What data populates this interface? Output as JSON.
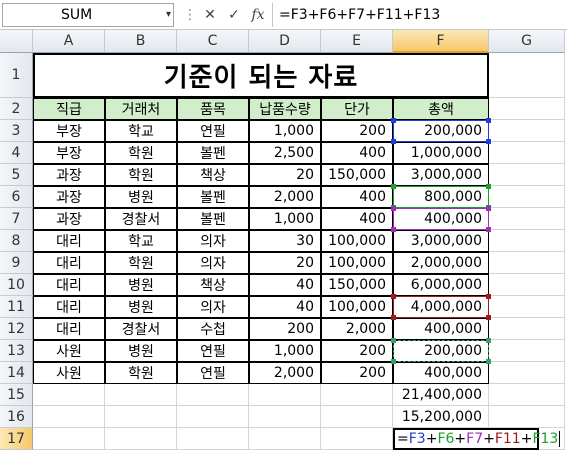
{
  "formula_bar": {
    "name_box": "SUM",
    "name_box_dropdown": "▾",
    "cancel_icon": "✕",
    "enter_icon": "✓",
    "fx_icon": "fx",
    "formula": "=F3+F6+F7+F11+F13"
  },
  "columns": [
    "A",
    "B",
    "C",
    "D",
    "E",
    "F",
    "G"
  ],
  "rows": [
    "1",
    "2",
    "3",
    "4",
    "5",
    "6",
    "7",
    "8",
    "9",
    "10",
    "11",
    "12",
    "13",
    "14",
    "15",
    "16",
    "17"
  ],
  "title": "기준이 되는 자료",
  "headers": [
    "직급",
    "거래처",
    "품목",
    "납품수량",
    "단가",
    "총액"
  ],
  "table": [
    [
      "부장",
      "학교",
      "연필",
      "1,000",
      "200",
      "200,000"
    ],
    [
      "부장",
      "학원",
      "볼펜",
      "2,500",
      "400",
      "1,000,000"
    ],
    [
      "과장",
      "학원",
      "책상",
      "20",
      "150,000",
      "3,000,000"
    ],
    [
      "과장",
      "병원",
      "볼펜",
      "2,000",
      "400",
      "800,000"
    ],
    [
      "과장",
      "경찰서",
      "볼펜",
      "1,000",
      "400",
      "400,000"
    ],
    [
      "대리",
      "학교",
      "의자",
      "30",
      "100,000",
      "3,000,000"
    ],
    [
      "대리",
      "학원",
      "의자",
      "20",
      "100,000",
      "2,000,000"
    ],
    [
      "대리",
      "병원",
      "책상",
      "40",
      "150,000",
      "6,000,000"
    ],
    [
      "대리",
      "병원",
      "의자",
      "40",
      "100,000",
      "4,000,000"
    ],
    [
      "대리",
      "경찰서",
      "수첩",
      "200",
      "2,000",
      "400,000"
    ],
    [
      "사원",
      "병원",
      "연필",
      "1,000",
      "200",
      "200,000"
    ],
    [
      "사원",
      "학원",
      "연필",
      "2,000",
      "200",
      "400,000"
    ]
  ],
  "extra": {
    "f15": "21,400,000",
    "f16": "15,200,000"
  },
  "active_cell": {
    "ref": "F17",
    "formula_parts": [
      {
        "text": "=",
        "color": "#000000"
      },
      {
        "text": "F3",
        "color": "#1f3fd6"
      },
      {
        "text": "+",
        "color": "#000000"
      },
      {
        "text": "F6",
        "color": "#1e9e2a"
      },
      {
        "text": "+",
        "color": "#000000"
      },
      {
        "text": "F7",
        "color": "#9b30b8"
      },
      {
        "text": "+",
        "color": "#000000"
      },
      {
        "text": "F11",
        "color": "#9c1c1c"
      },
      {
        "text": "+",
        "color": "#000000"
      },
      {
        "text": "F13",
        "color": "#1e9e2a"
      }
    ]
  },
  "ref_colors": {
    "F3": "#1f3fd6",
    "F6": "#1e9e2a",
    "F7": "#9b30b8",
    "F11": "#9c1c1c",
    "F13": "#3c9e6a"
  },
  "colors": {
    "header_fill": "#cfeec9",
    "active_header": "#f5c86a"
  }
}
